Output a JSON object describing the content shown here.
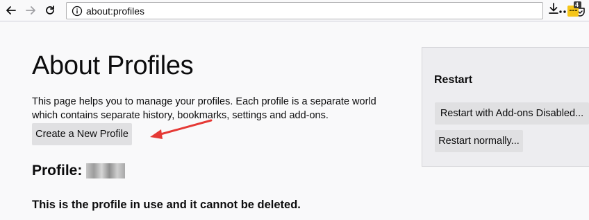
{
  "browser": {
    "url": "about:profiles",
    "extension_badge": "4"
  },
  "page": {
    "title": "About Profiles",
    "description": "This page helps you to manage your profiles. Each profile is a separate world which contains separate history, bookmarks, settings and add-ons.",
    "create_button": "Create a New Profile",
    "profile_heading": "Profile:",
    "in_use_note": "This is the profile in use and it cannot be deleted."
  },
  "restart": {
    "title": "Restart",
    "addons_disabled_button": "Restart with Add-ons Disabled...",
    "normal_button": "Restart normally..."
  },
  "colors": {
    "annotation_arrow": "#e53935",
    "badge": "#f5c518"
  }
}
